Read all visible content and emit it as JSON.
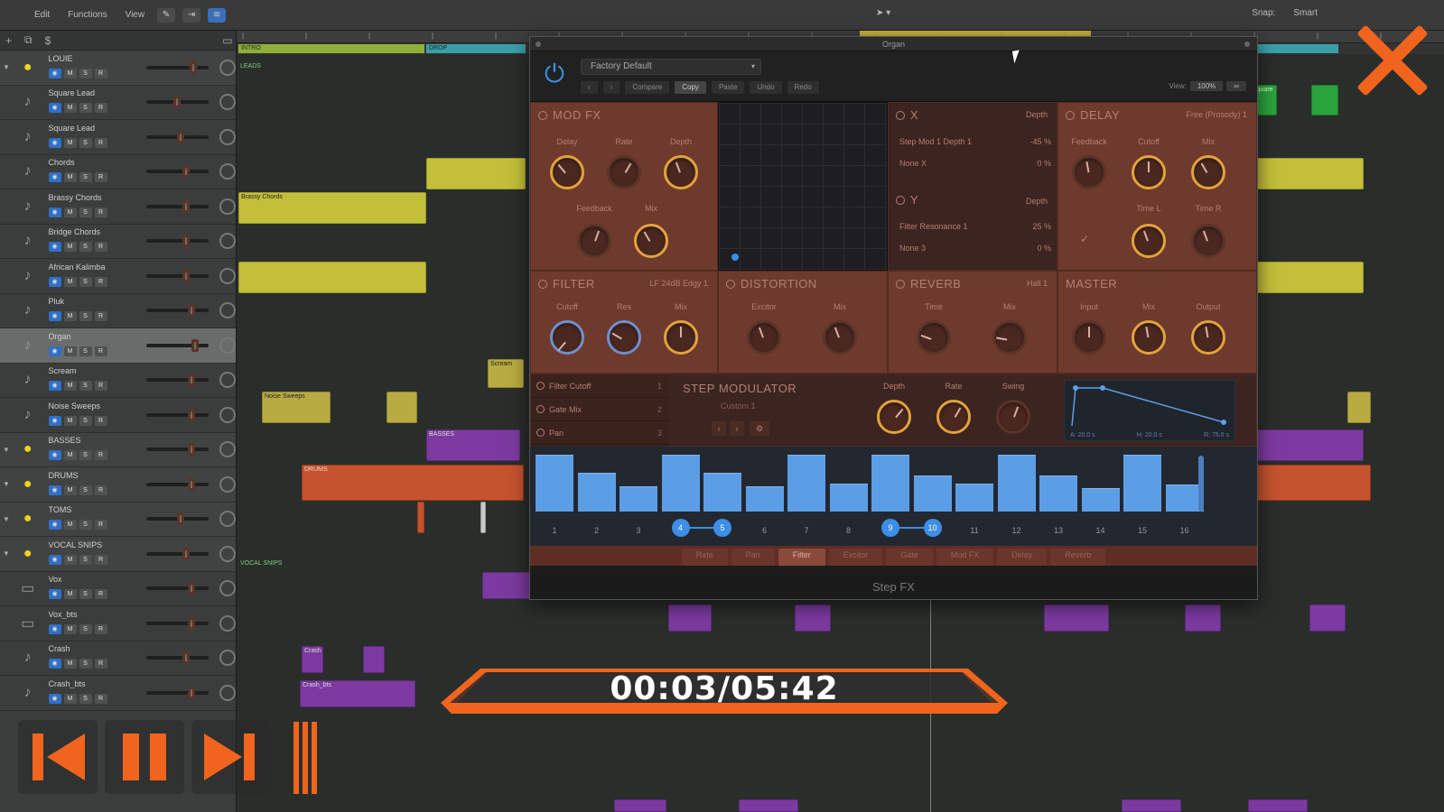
{
  "topbar": {
    "menus": [
      "Edit",
      "Functions",
      "View"
    ],
    "snap_label": "Snap:",
    "snap_value": "Smart"
  },
  "tracks": [
    {
      "name": "LOUIE",
      "type": "folder"
    },
    {
      "name": "Square Lead",
      "type": "inst"
    },
    {
      "name": "Square Lead",
      "type": "inst"
    },
    {
      "name": "Chords",
      "type": "inst"
    },
    {
      "name": "Brassy Chords",
      "type": "inst"
    },
    {
      "name": "Bridge Chords",
      "type": "inst"
    },
    {
      "name": "African Kalimba",
      "type": "inst"
    },
    {
      "name": "Pluk",
      "type": "inst"
    },
    {
      "name": "Organ",
      "type": "inst",
      "selected": true
    },
    {
      "name": "Scream",
      "type": "inst"
    },
    {
      "name": "Noise Sweeps",
      "type": "inst"
    },
    {
      "name": "BASSES",
      "type": "folder"
    },
    {
      "name": "DRUMS",
      "type": "folder"
    },
    {
      "name": "TOMS",
      "type": "folder"
    },
    {
      "name": "VOCAL SNIPS",
      "type": "folder"
    },
    {
      "name": "Vox",
      "type": "audio"
    },
    {
      "name": "Vox_bts",
      "type": "audio"
    },
    {
      "name": "Crash",
      "type": "inst"
    },
    {
      "name": "Crash_bts",
      "type": "inst"
    }
  ],
  "arrange": {
    "markers": [
      "INTRO",
      "DROP"
    ],
    "sections": [
      "LEADS",
      "VOCAL SNIPS"
    ],
    "region_labels": {
      "brassy": "Brassy Chords",
      "noise": "Noise Sweeps",
      "drums": "DRUMS",
      "bass": "BASSES",
      "square": "Square",
      "crash": "Crash",
      "crash_bts": "Crash_bts",
      "scream": "Scream"
    }
  },
  "plugin": {
    "window_title": "Organ",
    "preset": "Factory Default",
    "toolbar_buttons": [
      "Compare",
      "Copy",
      "Paste",
      "Undo",
      "Redo"
    ],
    "view_label": "View:",
    "view_value": "100%",
    "modfx": {
      "title": "MOD FX",
      "knobs": [
        "Delay",
        "Rate",
        "Depth",
        "Feedback",
        "Mix"
      ]
    },
    "x_panel": {
      "title": "X",
      "depth_label": "Depth",
      "rows": [
        {
          "label": "Step Mod 1 Depth 1",
          "value": "-45 %"
        },
        {
          "label": "None X",
          "value": "0 %"
        }
      ]
    },
    "y_panel": {
      "title": "Y",
      "depth_label": "Depth",
      "rows": [
        {
          "label": "Filter Resonance 1",
          "value": "25 %"
        },
        {
          "label": "None 3",
          "value": "0 %"
        }
      ]
    },
    "delay": {
      "title": "DELAY",
      "sub": "Free (Prosody) 1",
      "knobs": [
        "Feedback",
        "Cutoff",
        "Mix",
        "Time L",
        "Time R"
      ]
    },
    "filter": {
      "title": "FILTER",
      "sub": "LF 24dB Edgy 1",
      "knobs": [
        "Cutoff",
        "Res",
        "Mix"
      ]
    },
    "distortion": {
      "title": "DISTORTION",
      "knobs": [
        "Excitor",
        "Mix"
      ]
    },
    "reverb": {
      "title": "REVERB",
      "sub": "Hall 1",
      "knobs": [
        "Time",
        "Mix"
      ]
    },
    "master": {
      "title": "MASTER",
      "knobs": [
        "Input",
        "Mix",
        "Output"
      ]
    },
    "step_mod": {
      "title": "STEP MODULATOR",
      "preset": "Custom 1",
      "rows": [
        {
          "label": "Filter Cutoff",
          "num": "1"
        },
        {
          "label": "Gate Mix",
          "num": "2"
        },
        {
          "label": "Pan",
          "num": "3"
        }
      ],
      "knobs": [
        "Depth",
        "Rate",
        "Swing"
      ],
      "env_labels": [
        "A: 20.0 s",
        "H: 20.0 s",
        "R: 75.0 s"
      ]
    },
    "sequencer": {
      "values": [
        0.95,
        0.65,
        0.42,
        0.95,
        0.65,
        0.42,
        0.95,
        0.47,
        0.95,
        0.6,
        0.47,
        0.95,
        0.6,
        0.4,
        0.95,
        0.45
      ],
      "step_labels": [
        "1",
        "2",
        "3",
        "4",
        "5",
        "6",
        "7",
        "8",
        "9",
        "10",
        "11",
        "12",
        "13",
        "14",
        "15",
        "16"
      ],
      "linked_pairs": [
        [
          4,
          5
        ],
        [
          9,
          10
        ]
      ]
    },
    "tabs": [
      "Rate",
      "Pan",
      "Filter",
      "Excitor",
      "Gate",
      "Mod FX",
      "Delay",
      "Reverb"
    ],
    "active_tab": "Filter",
    "footer": "Step FX"
  },
  "player": {
    "timecode": "00:03/05:42",
    "accent": "#f0641e"
  }
}
